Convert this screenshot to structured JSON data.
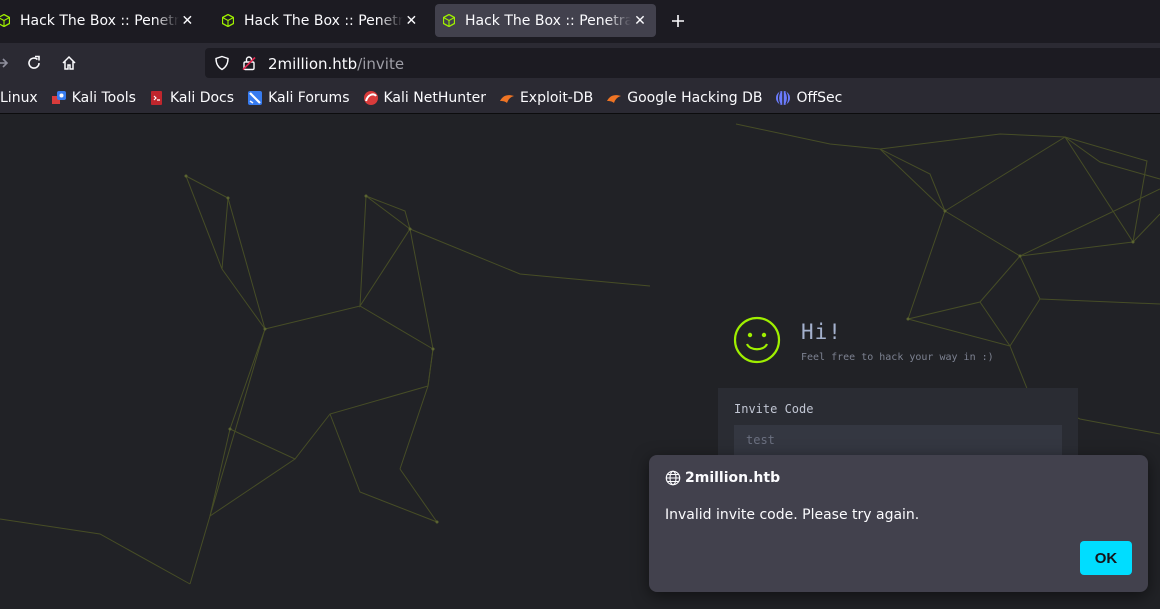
{
  "browser": {
    "tabs": [
      {
        "title": "Hack The Box :: Penetration Testing Labs",
        "active": false
      },
      {
        "title": "Hack The Box :: Penetration Testing Labs",
        "active": false
      },
      {
        "title": "Hack The Box :: Penetration Testing Labs",
        "active": true
      }
    ],
    "new_tab_icon": "plus-icon",
    "url": {
      "host": "2million.htb",
      "path": "/invite"
    },
    "bookmarks": [
      {
        "label": "Linux",
        "icon": "kali-icon"
      },
      {
        "label": "Kali Tools",
        "icon": "kali-tools-icon"
      },
      {
        "label": "Kali Docs",
        "icon": "kali-docs-icon"
      },
      {
        "label": "Kali Forums",
        "icon": "kali-forums-icon"
      },
      {
        "label": "Kali NetHunter",
        "icon": "nethunter-icon"
      },
      {
        "label": "Exploit-DB",
        "icon": "exploit-db-icon"
      },
      {
        "label": "Google Hacking DB",
        "icon": "ghdb-icon"
      },
      {
        "label": "OffSec",
        "icon": "offsec-icon"
      }
    ]
  },
  "page": {
    "greeting": "Hi!",
    "subtitle": "Feel free to hack your way in :)",
    "form": {
      "label": "Invite Code",
      "value": "test"
    }
  },
  "dialog": {
    "host": "2million.htb",
    "message": "Invalid invite code. Please try again.",
    "ok_label": "OK"
  },
  "colors": {
    "accent": "#00ddff",
    "smiley": "#9fef00",
    "page_bg": "#212226"
  }
}
